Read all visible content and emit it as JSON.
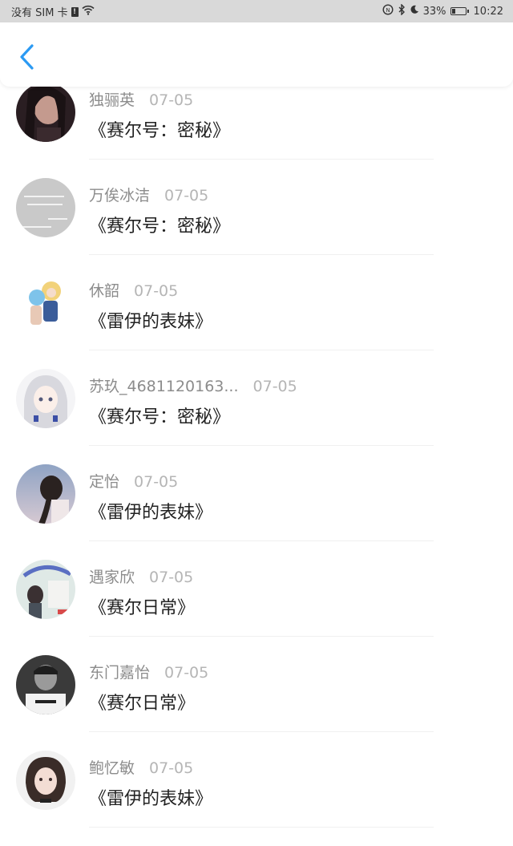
{
  "status_bar": {
    "carrier": "没有 SIM 卡",
    "sim_alert": "!",
    "battery_percent": "33%",
    "battery_level": 0.33,
    "time": "10:22",
    "icons": [
      "sim-alert-icon",
      "wifi-icon",
      "nfc-icon",
      "bluetooth-icon",
      "moon-icon",
      "battery-icon"
    ]
  },
  "header": {
    "back_icon": "chevron-left-icon",
    "accent_color": "#2b9af3"
  },
  "items": [
    {
      "name": "独骊英",
      "date": "07-05",
      "title": "《赛尔号：密秘》"
    },
    {
      "name": "万俟冰洁",
      "date": "07-05",
      "title": "《赛尔号：密秘》"
    },
    {
      "name": "休韶",
      "date": "07-05",
      "title": "《雷伊的表妹》"
    },
    {
      "name": "苏玖_4681120163...",
      "date": "07-05",
      "title": "《赛尔号：密秘》"
    },
    {
      "name": "定怡",
      "date": "07-05",
      "title": "《雷伊的表妹》"
    },
    {
      "name": "遇家欣",
      "date": "07-05",
      "title": "《赛尔日常》"
    },
    {
      "name": "东门嘉怡",
      "date": "07-05",
      "title": "《赛尔日常》"
    },
    {
      "name": "鲍忆敏",
      "date": "07-05",
      "title": "《雷伊的表妹》"
    }
  ]
}
